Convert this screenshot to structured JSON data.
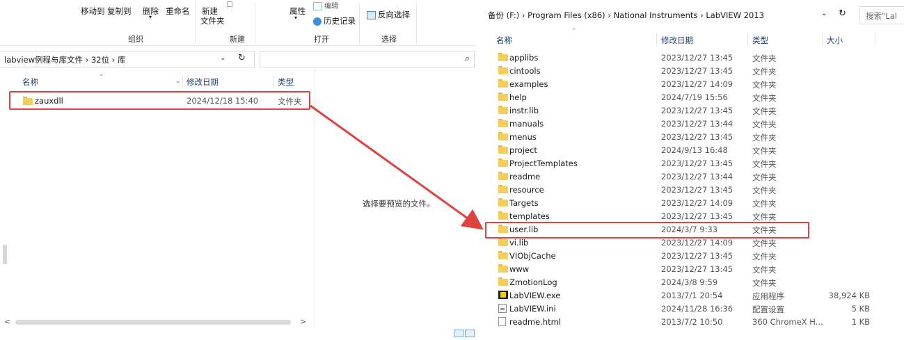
{
  "left_window": {
    "ribbon": {
      "move_to": "移动到",
      "copy_to": "复制到",
      "delete": "删除",
      "rename": "重命名",
      "new_folder_line1": "新建",
      "new_folder_line2": "文件夹",
      "properties": "属性",
      "edit": "编辑",
      "history": "历史记录",
      "invert_select": "反向选择",
      "group_organize": "组织",
      "group_new": "新建",
      "group_open": "打开",
      "group_select": "选择"
    },
    "address": {
      "seg1": "labview例程与库文件",
      "seg2": "32位",
      "seg3": "库"
    },
    "columns": {
      "name": "名称",
      "date": "修改日期",
      "type": "类型"
    },
    "rows": [
      {
        "name": "zauxdll",
        "date": "2024/12/18 15:40",
        "type": "文件夹"
      }
    ],
    "preview_text": "选择要预览的文件。"
  },
  "right_window": {
    "address": {
      "seg1": "备份 (F:)",
      "seg2": "Program Files (x86)",
      "seg3": "National Instruments",
      "seg4": "LabVIEW 2013"
    },
    "search_placeholder": "搜索\"Lal",
    "columns": {
      "name": "名称",
      "date": "修改日期",
      "type": "类型",
      "size": "大小"
    },
    "rows": [
      {
        "icon": "folder",
        "name": "applibs",
        "date": "2023/12/27 13:45",
        "type": "文件夹",
        "size": ""
      },
      {
        "icon": "folder",
        "name": "cintools",
        "date": "2023/12/27 13:45",
        "type": "文件夹",
        "size": ""
      },
      {
        "icon": "folder",
        "name": "examples",
        "date": "2023/12/27 14:09",
        "type": "文件夹",
        "size": ""
      },
      {
        "icon": "folder",
        "name": "help",
        "date": "2024/7/19 15:56",
        "type": "文件夹",
        "size": ""
      },
      {
        "icon": "folder",
        "name": "instr.lib",
        "date": "2023/12/27 13:45",
        "type": "文件夹",
        "size": ""
      },
      {
        "icon": "folder",
        "name": "manuals",
        "date": "2023/12/27 13:44",
        "type": "文件夹",
        "size": ""
      },
      {
        "icon": "folder",
        "name": "menus",
        "date": "2023/12/27 13:45",
        "type": "文件夹",
        "size": ""
      },
      {
        "icon": "folder",
        "name": "project",
        "date": "2024/9/13 16:48",
        "type": "文件夹",
        "size": ""
      },
      {
        "icon": "folder",
        "name": "ProjectTemplates",
        "date": "2023/12/27 13:45",
        "type": "文件夹",
        "size": ""
      },
      {
        "icon": "folder",
        "name": "readme",
        "date": "2023/12/27 13:44",
        "type": "文件夹",
        "size": ""
      },
      {
        "icon": "folder",
        "name": "resource",
        "date": "2023/12/27 13:45",
        "type": "文件夹",
        "size": ""
      },
      {
        "icon": "folder",
        "name": "Targets",
        "date": "2023/12/27 14:09",
        "type": "文件夹",
        "size": ""
      },
      {
        "icon": "folder",
        "name": "templates",
        "date": "2023/12/27 13:45",
        "type": "文件夹",
        "size": ""
      },
      {
        "icon": "folder",
        "name": "user.lib",
        "date": "2024/3/7 9:33",
        "type": "文件夹",
        "size": ""
      },
      {
        "icon": "folder",
        "name": "vi.lib",
        "date": "2023/12/27 14:09",
        "type": "文件夹",
        "size": ""
      },
      {
        "icon": "folder",
        "name": "VIObjCache",
        "date": "2023/12/27 13:45",
        "type": "文件夹",
        "size": ""
      },
      {
        "icon": "folder",
        "name": "www",
        "date": "2023/12/27 13:45",
        "type": "文件夹",
        "size": ""
      },
      {
        "icon": "folder",
        "name": "ZmotionLog",
        "date": "2024/3/8 9:59",
        "type": "文件夹",
        "size": ""
      },
      {
        "icon": "exe",
        "name": "LabVIEW.exe",
        "date": "2013/7/1 20:54",
        "type": "应用程序",
        "size": "38,924 KB"
      },
      {
        "icon": "ini",
        "name": "LabVIEW.ini",
        "date": "2024/11/28 16:36",
        "type": "配置设置",
        "size": "5 KB"
      },
      {
        "icon": "doc",
        "name": "readme.html",
        "date": "2013/7/2 10:50",
        "type": "360 ChromeX H...",
        "size": "1 KB"
      }
    ]
  },
  "colors": {
    "highlight": "#e0423f",
    "folder": "#f4cd5c",
    "header_text": "#1a3f6e"
  }
}
